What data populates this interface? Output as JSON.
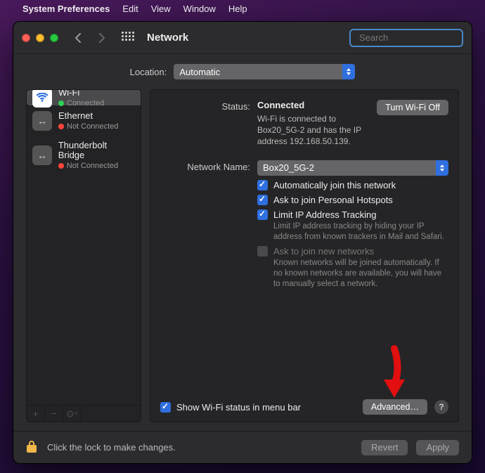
{
  "menubar": {
    "app": "System Preferences",
    "items": [
      "Edit",
      "View",
      "Window",
      "Help"
    ]
  },
  "window": {
    "title": "Network",
    "search_placeholder": "Search"
  },
  "location": {
    "label": "Location:",
    "value": "Automatic"
  },
  "sidebar": {
    "items": [
      {
        "name": "Wi-Fi",
        "status": "Connected",
        "connected": true,
        "icon": "wifi"
      },
      {
        "name": "Ethernet",
        "status": "Not Connected",
        "connected": false,
        "icon": "eth"
      },
      {
        "name": "Thunderbolt Bridge",
        "status": "Not Connected",
        "connected": false,
        "icon": "eth"
      }
    ]
  },
  "pane": {
    "status_label": "Status:",
    "status_value": "Connected",
    "status_desc": "Wi-Fi is connected to Box20_5G-2 and has the IP address 192.168.50.139.",
    "turn_off_label": "Turn Wi-Fi Off",
    "network_name_label": "Network Name:",
    "network_name_value": "Box20_5G-2",
    "opt_auto_join": "Automatically join this network",
    "opt_personal_hotspot": "Ask to join Personal Hotspots",
    "opt_limit_tracking": "Limit IP Address Tracking",
    "opt_limit_tracking_desc": "Limit IP address tracking by hiding your IP address from known trackers in Mail and Safari.",
    "opt_ask_new": "Ask to join new networks",
    "opt_ask_new_desc": "Known networks will be joined automatically. If no known networks are available, you will have to manually select a network.",
    "show_status_menubar": "Show Wi-Fi status in menu bar",
    "advanced_label": "Advanced…"
  },
  "footer": {
    "lock_text": "Click the lock to make changes.",
    "revert": "Revert",
    "apply": "Apply"
  }
}
